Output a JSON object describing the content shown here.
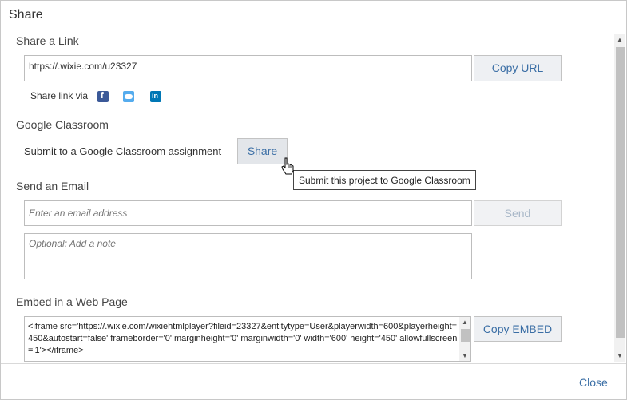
{
  "dialog": {
    "title": "Share"
  },
  "share_link": {
    "section_title": "Share a Link",
    "url": "https://.wixie.com/u23327",
    "copy_button": "Copy URL",
    "share_via_label": "Share link via",
    "icons": [
      "facebook-icon",
      "twitter-icon",
      "linkedin-icon"
    ]
  },
  "google_classroom": {
    "section_title": "Google Classroom",
    "description": "Submit to a Google Classroom assignment",
    "share_button": "Share",
    "tooltip": "Submit this project to Google Classroom"
  },
  "email": {
    "section_title": "Send an Email",
    "email_placeholder": "Enter an email address",
    "send_button": "Send",
    "note_placeholder": "Optional: Add a note"
  },
  "embed": {
    "section_title": "Embed in a Web Page",
    "code": "<iframe src='https://.wixie.com/wixiehtmlplayer?fileid=23327&entitytype=User&playerwidth=600&playerheight=450&autostart=false' frameborder='0' marginheight='0' marginwidth='0' width='600' height='450' allowfullscreen='1'></iframe>",
    "copy_button": "Copy EMBED"
  },
  "footer": {
    "close_label": "Close"
  },
  "colors": {
    "accent": "#3a6ea5",
    "facebook": "#3b5998",
    "twitter": "#55acee",
    "linkedin": "#0077b5"
  }
}
